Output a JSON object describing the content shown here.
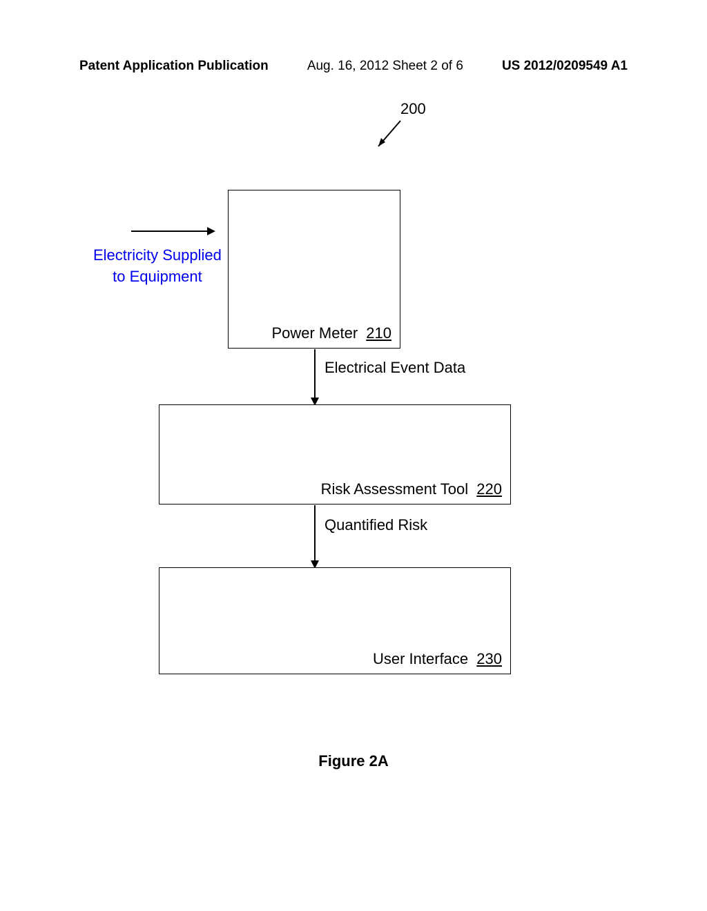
{
  "header": {
    "left": "Patent Application Publication",
    "center": "Aug. 16, 2012  Sheet 2 of 6",
    "right": "US 2012/0209549 A1"
  },
  "diagram": {
    "reference": "200",
    "input_label_line1": "Electricity Supplied",
    "input_label_line2": "to Equipment",
    "boxes": {
      "power_meter": {
        "label": "Power Meter",
        "ref": "210"
      },
      "risk_tool": {
        "label": "Risk Assessment Tool",
        "ref": "220"
      },
      "user_interface": {
        "label": "User Interface",
        "ref": "230"
      }
    },
    "flows": {
      "flow1": "Electrical Event Data",
      "flow2": "Quantified Risk"
    }
  },
  "caption": "Figure 2A"
}
